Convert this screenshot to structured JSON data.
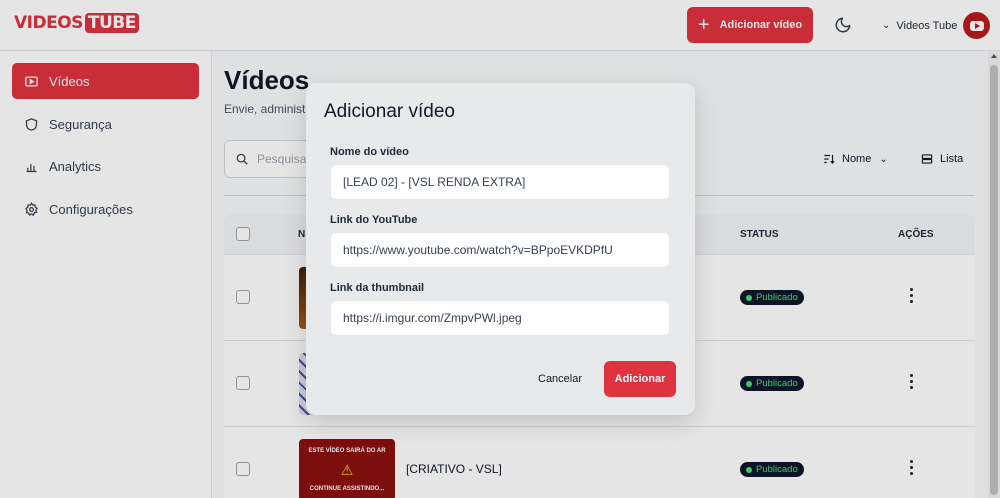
{
  "header": {
    "logo_part1": "VIDEOS",
    "logo_part2": "TUBE",
    "add_button_label": "Adicionar vídeo",
    "user_name": "Videos Tube"
  },
  "sidebar": {
    "items": [
      {
        "label": "Vídeos",
        "icon": "video-icon",
        "active": true
      },
      {
        "label": "Segurança",
        "icon": "shield-icon",
        "active": false
      },
      {
        "label": "Analytics",
        "icon": "bar-chart-icon",
        "active": false
      },
      {
        "label": "Configurações",
        "icon": "gear-icon",
        "active": false
      }
    ]
  },
  "main": {
    "title": "Vídeos",
    "subtitle": "Envie, administ",
    "search_placeholder": "Pesquisar",
    "sort_label": "Nome",
    "view_label": "Lista",
    "table": {
      "headers": {
        "name": "N",
        "status": "STATUS",
        "actions": "AÇÕES"
      },
      "rows": [
        {
          "title": "",
          "status": "Publicado"
        },
        {
          "title": "",
          "status": "Publicado"
        },
        {
          "title": "[CRIATIVO - VSL]",
          "status": "Publicado",
          "thumb_text_top": "ESTE VÍDEO SAIRÁ DO AR",
          "thumb_text_bottom": "CONTINUE ASSISTINDO..."
        }
      ]
    }
  },
  "modal": {
    "title": "Adicionar vídeo",
    "fields": [
      {
        "label": "Nome do vídeo",
        "value": "[LEAD 02] - [VSL RENDA EXTRA]"
      },
      {
        "label": "Link do YouTube",
        "value": "https://www.youtube.com/watch?v=BPpoEVKDPfU"
      },
      {
        "label": "Link da thumbnail",
        "value": "https://i.imgur.com/ZmpvPWl.jpeg"
      }
    ],
    "cancel_label": "Cancelar",
    "submit_label": "Adicionar"
  },
  "colors": {
    "brand": "#e0333f",
    "status_green": "#4ade80",
    "badge_bg": "#0f172a"
  }
}
